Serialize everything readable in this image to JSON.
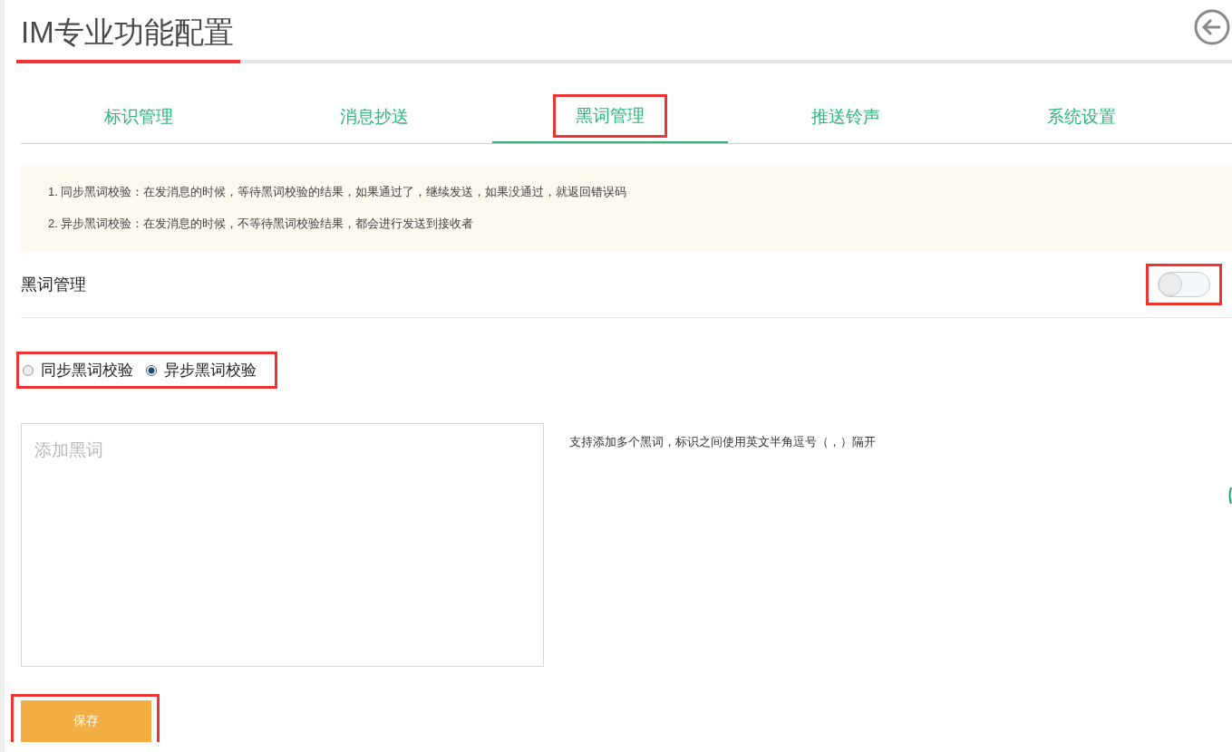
{
  "header": {
    "title": "IM专业功能配置",
    "title_annotated": true
  },
  "tabs": [
    {
      "label": "标识管理",
      "selected": false,
      "annotated": false
    },
    {
      "label": "消息抄送",
      "selected": false,
      "annotated": false
    },
    {
      "label": "黑词管理",
      "selected": true,
      "annotated": true
    },
    {
      "label": "推送铃声",
      "selected": false,
      "annotated": false
    },
    {
      "label": "系统设置",
      "selected": false,
      "annotated": false
    }
  ],
  "notice": [
    "1. 同步黑词校验：在发消息的时候，等待黑词校验的结果，如果通过了，继续发送，如果没通过，就返回错误码",
    "2. 异步黑词校验：在发消息的时候，不等待黑词校验结果，都会进行发送到接收者"
  ],
  "setting": {
    "label": "黑词管理",
    "on": false,
    "annotated": true
  },
  "modes": {
    "annotated": true,
    "options": [
      {
        "label": "同步黑词校验",
        "selected": false
      },
      {
        "label": "异步黑词校验",
        "selected": true
      }
    ]
  },
  "words_field": {
    "placeholder": "添加黑词",
    "hint": "支持添加多个黑词，标识之间使用英文半角逗号（，）隔开"
  },
  "save_button": {
    "label": "保存",
    "annotated": true
  }
}
